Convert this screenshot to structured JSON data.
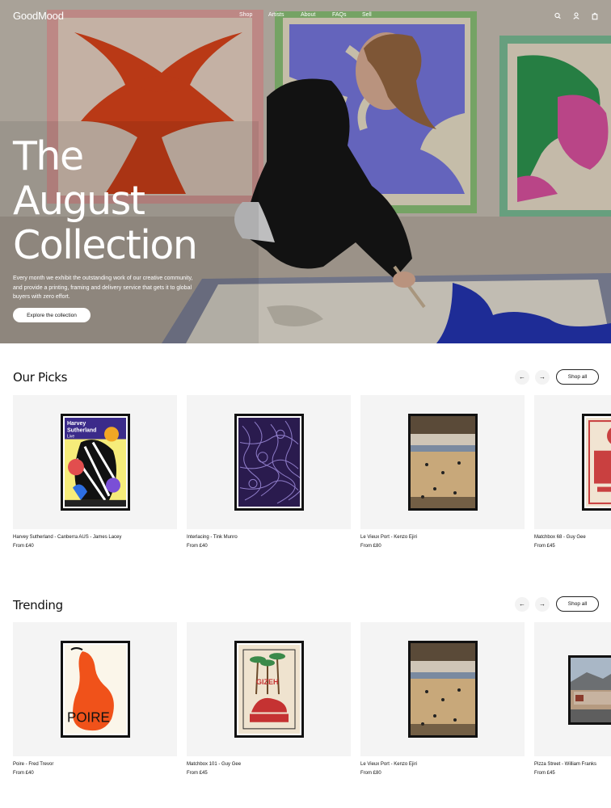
{
  "brand": "GoodMood",
  "nav": {
    "links": [
      "Shop",
      "Artists",
      "About",
      "FAQs",
      "Sell"
    ],
    "icons": [
      "search-icon",
      "account-icon",
      "cart-icon"
    ]
  },
  "hero": {
    "title_lines": [
      "The",
      "August",
      "Collection"
    ],
    "description": "Every month we exhibit the outstanding work of our creative community, and provide a printing, framing and delivery service that gets it to global buyers with zero effort.",
    "cta": "Explore the collection"
  },
  "sections": [
    {
      "title": "Our Picks",
      "prev_icon": "←",
      "next_icon": "→",
      "shop_all": "Shop all",
      "products": [
        {
          "name": "Harvey Sutherland - Canberra AUS - James Lacey",
          "price": "From £40",
          "poster_text": [
            "Harvey",
            "Sutherland",
            "Live"
          ]
        },
        {
          "name": "Interlacing - Tink Munro",
          "price": "From £40"
        },
        {
          "name": "Le Vieux Port - Kenzo Ejiri",
          "price": "From £80"
        },
        {
          "name": "Matchbox 68 - Guy Gee",
          "price": "From £45"
        }
      ]
    },
    {
      "title": "Trending",
      "prev_icon": "←",
      "next_icon": "→",
      "shop_all": "Shop all",
      "products": [
        {
          "name": "Poire - Fred Trevor",
          "price": "From £40",
          "poster_text": [
            "POIRE"
          ]
        },
        {
          "name": "Matchbox 101 - Guy Gee",
          "price": "From £45",
          "poster_text": [
            "GIZEH"
          ]
        },
        {
          "name": "Le Vieux Port - Kenzo Ejiri",
          "price": "From £80"
        },
        {
          "name": "Pizza Street - William Franks",
          "price": "From £45"
        }
      ]
    }
  ],
  "colors": {
    "accent_orange": "#e2461c",
    "accent_blue": "#3e35c8",
    "accent_green": "#2f9a52",
    "accent_pink": "#e255a5"
  }
}
